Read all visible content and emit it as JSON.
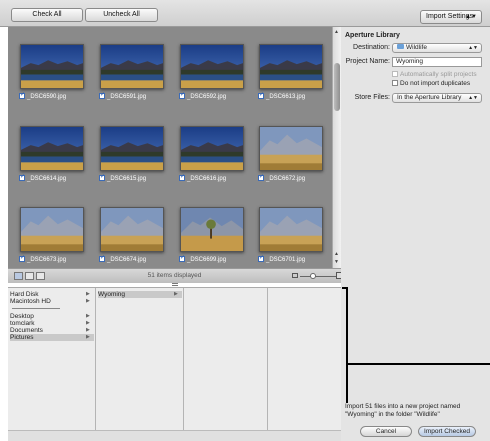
{
  "toolbar": {
    "check_all": "Check All",
    "uncheck_all": "Uncheck All",
    "import_settings": "Import Settings",
    "import_settings_arrows": "▲▼"
  },
  "thumbnails": [
    {
      "name": "_DSC6590.jpg",
      "kind": "lake-dusk"
    },
    {
      "name": "_DSC6591.jpg",
      "kind": "lake-dusk"
    },
    {
      "name": "_DSC6592.jpg",
      "kind": "lake-dusk"
    },
    {
      "name": "_DSC6613.jpg",
      "kind": "lake-dusk"
    },
    {
      "name": "_DSC6614.jpg",
      "kind": "lake-dusk"
    },
    {
      "name": "_DSC6615.jpg",
      "kind": "lake-dusk"
    },
    {
      "name": "_DSC6616.jpg",
      "kind": "lake-dusk"
    },
    {
      "name": "_DSC6672.jpg",
      "kind": "mountain-meadow"
    },
    {
      "name": "_DSC6673.jpg",
      "kind": "mountain-meadow"
    },
    {
      "name": "_DSC6674.jpg",
      "kind": "mountain-meadow"
    },
    {
      "name": "_DSC6699.jpg",
      "kind": "mountain-tree"
    },
    {
      "name": "_DSC6701.jpg",
      "kind": "mountain-meadow"
    }
  ],
  "browser": {
    "items_displayed": "51 items displayed"
  },
  "panel": {
    "title": "Aperture Library",
    "destination_label": "Destination:",
    "destination_value": "Wildlife",
    "project_name_label": "Project Name:",
    "project_name_value": "Wyoming",
    "split_projects": "Automatically split projects",
    "no_duplicates": "Do not import duplicates",
    "store_files_label": "Store Files:",
    "store_files_value": "In the Aperture Library",
    "arrows": "▲▼",
    "summary_line1": "Import 51 files into a new project named",
    "summary_line2": "\"Wyoming\" in the folder \"Wildlife\"",
    "cancel": "Cancel",
    "import_checked": "Import Checked"
  },
  "columns": {
    "col1": [
      {
        "label": "Hard Disk",
        "arrow": "▶"
      },
      {
        "label": "Macintosh HD",
        "arrow": "▶"
      },
      {
        "label": "Desktop",
        "arrow": "▶"
      },
      {
        "label": "tomclark",
        "arrow": "▶"
      },
      {
        "label": "Documents",
        "arrow": "▶"
      },
      {
        "label": "Pictures",
        "arrow": "▶"
      }
    ],
    "col2": [
      {
        "label": "Wyoming",
        "arrow": "▶"
      }
    ]
  },
  "colors": {
    "browser_bg": "#8a8a8a",
    "panel_bg": "#e4e4e4",
    "checkbox_blue": "#2a5db0"
  }
}
